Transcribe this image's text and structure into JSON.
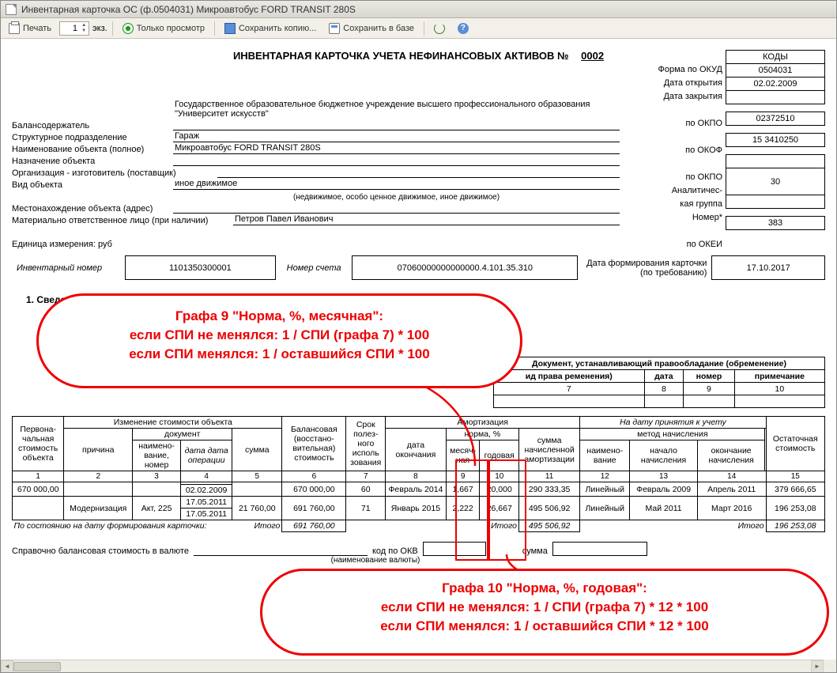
{
  "window": {
    "title": "Инвентарная карточка ОС (ф.0504031) Микроавтобус FORD TRANSIT 280S"
  },
  "toolbar": {
    "print": "Печать",
    "copies_value": "1",
    "copies_suffix": "экз.",
    "preview": "Только просмотр",
    "save_copy": "Сохранить копию...",
    "save_db": "Сохранить в базе"
  },
  "doc": {
    "title_main": "ИНВЕНТАРНАЯ КАРТОЧКА УЧЕТА НЕФИНАНСОВЫХ АКТИВОВ   №",
    "title_num": "0002",
    "codes_header": "КОДЫ",
    "codes": {
      "okud": "0504031",
      "open_date": "02.02.2009",
      "close_date": "",
      "okpo1": "02372510",
      "okof": "15 3410250",
      "okpo2": "",
      "group": "30",
      "num": "",
      "okei": "383"
    },
    "code_labels": {
      "okud": "Форма по ОКУД",
      "open": "Дата открытия",
      "close": "Дата закрытия",
      "okpo": "по ОКПО",
      "okof": "по ОКОФ",
      "okpo2": "по ОКПО",
      "analytic": "Аналитичес-",
      "group": "кая группа",
      "num": "Номер*",
      "okei": "по ОКЕИ"
    },
    "hdr": {
      "balance_holder_lbl": "Балансодержатель",
      "balance_holder_val": "Государственное образовательное бюджетное учреждение высшего профессионального образования \"Университет искусств\"",
      "unit_lbl": "Структурное подразделение",
      "unit_val": "Гараж",
      "object_lbl": "Наименование объекта (полное)",
      "object_val": "Микроавтобус FORD TRANSIT 280S",
      "purpose_lbl": "Назначение объекта",
      "purpose_val": "",
      "manufacturer_lbl": "Организация - изготовитель (поставщик)",
      "manufacturer_val": "",
      "kind_lbl": "Вид объекта",
      "kind_val": "иное движимое",
      "kind_hint": "(недвижимое, особо ценное движимое, иное движимое)",
      "location_lbl": "Местонахождение объекта (адрес)",
      "location_val": "",
      "responsible_lbl": "Материально ответственное лицо (при наличии)",
      "responsible_val": "Петров Павел Иванович",
      "measure_lbl": "Единица измерения: руб",
      "measure_val": ""
    },
    "info": {
      "inv_num_lbl": "Инвентарный номер",
      "inv_num_val": "1101350300001",
      "acct_lbl": "Номер счета",
      "acct_val": "07060000000000000.4.101.35.310",
      "form_date_lbl": "Дата формирования карточки (по требованию)",
      "form_date_val": "17.10.2017"
    },
    "section1": "1. Сведения об объекте",
    "docs_header": "Документ, устанавливающий правообладание (обременение)",
    "docs_cols": {
      "c1": "ид права\nременения)",
      "c2": "дата",
      "c3": "номер",
      "c4": "примечание"
    },
    "docs_nums": {
      "n1": "7",
      "n2": "8",
      "n3": "9",
      "n4": "10"
    },
    "tbl": {
      "h_initial": "Первона-\nчальная\nстоимость\nобъекта",
      "h_change": "Изменение стоимости объекта",
      "h_reason": "причина",
      "h_doc": "документ",
      "h_docname": "наимено-\nвание,\nномер",
      "h_docdate": "дата\nдата\nоперации",
      "h_sum": "сумма",
      "h_balance": "Балансовая\n(восстано-\nвительная)\nстоимость",
      "h_term": "Срок\nполез-\nного\nисполь\nзования",
      "h_amort": "Амортизация",
      "h_enddate": "дата\nокончания",
      "h_rate": "норма, %",
      "h_monthly": "месяч-\nная",
      "h_yearly": "годовая",
      "h_accrued": "сумма\nначисленной\nамортизации",
      "h_accept": "На дату принятия к учету",
      "h_method": "метод начисления",
      "h_mname": "наимено-\nвание",
      "h_mstart": "начало\nначисления",
      "h_mend": "окончание\nначисления",
      "h_residual": "Остаточная\nстоимость",
      "nums": [
        "1",
        "2",
        "3",
        "4",
        "5",
        "6",
        "7",
        "8",
        "9",
        "10",
        "11",
        "12",
        "13",
        "14",
        "15"
      ],
      "rows": [
        {
          "c1": "670 000,00",
          "c2": "",
          "c3": "",
          "c4a": "",
          "c4b": "02.02.2009",
          "c5": "",
          "c6": "670 000,00",
          "c7": "60",
          "c8": "Февраль 2014",
          "c9": "1,667",
          "c10": "20,000",
          "c11": "290 333,35",
          "c12": "Линейный",
          "c13": "Февраль 2009",
          "c14": "Апрель 2011",
          "c15": "379 666,65"
        },
        {
          "c1": "",
          "c2": "Модернизация",
          "c3": "Акт, 225",
          "c4a": "17.05.2011",
          "c4b": "17.05.2011",
          "c5": "21 760,00",
          "c6": "691 760,00",
          "c7": "71",
          "c8": "Январь 2015",
          "c9": "2,222",
          "c10": "26,667",
          "c11": "495 506,92",
          "c12": "Линейный",
          "c13": "Май 2011",
          "c14": "Март 2016",
          "c15": "196 253,08"
        }
      ],
      "totals_lbl": "По состоянию на дату формирования карточки:",
      "totals_word": "Итого",
      "tot_c6": "691 760,00",
      "tot_word2": "Итого",
      "tot_c11": "495 506,92",
      "tot_word3": "Итого",
      "tot_c15": "196 253,08"
    },
    "foot": {
      "bal_currency_lbl": "Справочно балансовая стоимость в валюте",
      "currency_hint": "(наименование валюты)",
      "okv_lbl": "код по ОКВ",
      "sum_lbl": "сумма"
    }
  },
  "callouts": {
    "c1_l1": "Графа 9 \"Норма, %, месячная\":",
    "c1_l2": "если СПИ не менялся: 1 / СПИ (графа 7) * 100",
    "c1_l3": "если СПИ менялся: 1 / оставшийся СПИ * 100",
    "c2_l1": "Графа 10 \"Норма, %, годовая\":",
    "c2_l2": "если СПИ не менялся: 1 / СПИ (графа 7) * 12 * 100",
    "c2_l3": "если СПИ менялся: 1 / оставшийся СПИ * 12 * 100"
  }
}
